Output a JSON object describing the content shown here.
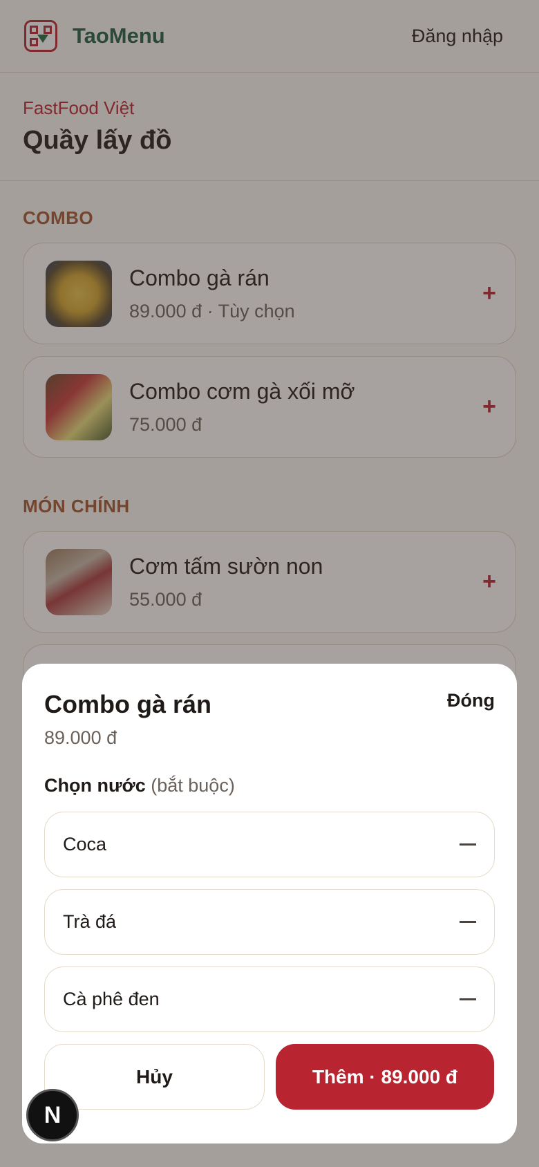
{
  "header": {
    "brand": "TaoMenu",
    "login": "Đăng nhập"
  },
  "restaurant": {
    "name": "FastFood Việt",
    "title": "Quầy lấy đồ"
  },
  "sections": [
    {
      "title": "COMBO",
      "items": [
        {
          "name": "Combo gà rán",
          "subtitle": "89.000 đ · Tùy chọn",
          "action": "+"
        },
        {
          "name": "Combo cơm gà xối mỡ",
          "subtitle": "75.000 đ",
          "action": "+"
        }
      ]
    },
    {
      "title": "MÓN CHÍNH",
      "items": [
        {
          "name": "Cơm tấm sườn non",
          "subtitle": "55.000 đ",
          "action": "+"
        }
      ]
    }
  ],
  "sheet": {
    "title": "Combo gà rán",
    "close": "Đóng",
    "price": "89.000 đ",
    "group_label": "Chọn nước",
    "group_required": "(bắt buộc)",
    "options": [
      "Coca",
      "Trà đá",
      "Cà phê đen"
    ],
    "cancel": "Hủy",
    "add": "Thêm · 89.000 đ"
  },
  "badge": {
    "letter": "N"
  },
  "colors": {
    "accent": "#b8242f",
    "brand": "#1e5b40",
    "section": "#a0522d"
  }
}
